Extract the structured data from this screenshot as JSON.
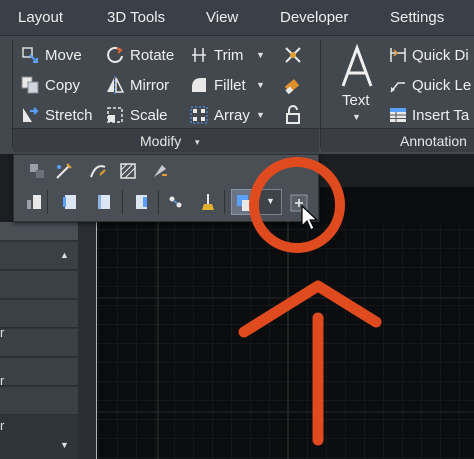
{
  "tabs": [
    "Layout",
    "3D Tools",
    "View",
    "Developer",
    "Settings"
  ],
  "modify": {
    "title": "Modify",
    "col1": [
      "Move",
      "Copy",
      "Stretch"
    ],
    "col2": [
      "Rotate",
      "Mirror",
      "Scale"
    ],
    "col3": [
      "Trim",
      "Fillet",
      "Array"
    ]
  },
  "annotation": {
    "title": "Annotation",
    "text_label": "Text",
    "items": [
      "Quick Di",
      "Quick Le",
      "Insert Ta"
    ]
  },
  "palette_letters": [
    "r",
    "r",
    "r"
  ],
  "icons": {
    "move": "move-icon",
    "copy": "copy-icon",
    "stretch": "stretch-icon",
    "rotate": "rotate-icon",
    "mirror": "mirror-icon",
    "scale": "scale-icon",
    "trim": "trim-icon",
    "fillet": "fillet-icon",
    "array": "array-icon",
    "explode": "explode-icon",
    "erase": "erase-icon",
    "unlock": "unlock-icon",
    "text": "text-icon",
    "quick-dimension": "quick-dimension-icon",
    "quick-leader": "quick-leader-icon",
    "insert-table": "insert-table-icon",
    "highlighted-tool": "pin-icon"
  },
  "colors": {
    "ribbon": "#43484f",
    "tabbar": "#3b4048",
    "canvas": "#0b0c0e",
    "annotation_marker": "#e04a1f",
    "accent_blue": "#5aa0ff"
  }
}
